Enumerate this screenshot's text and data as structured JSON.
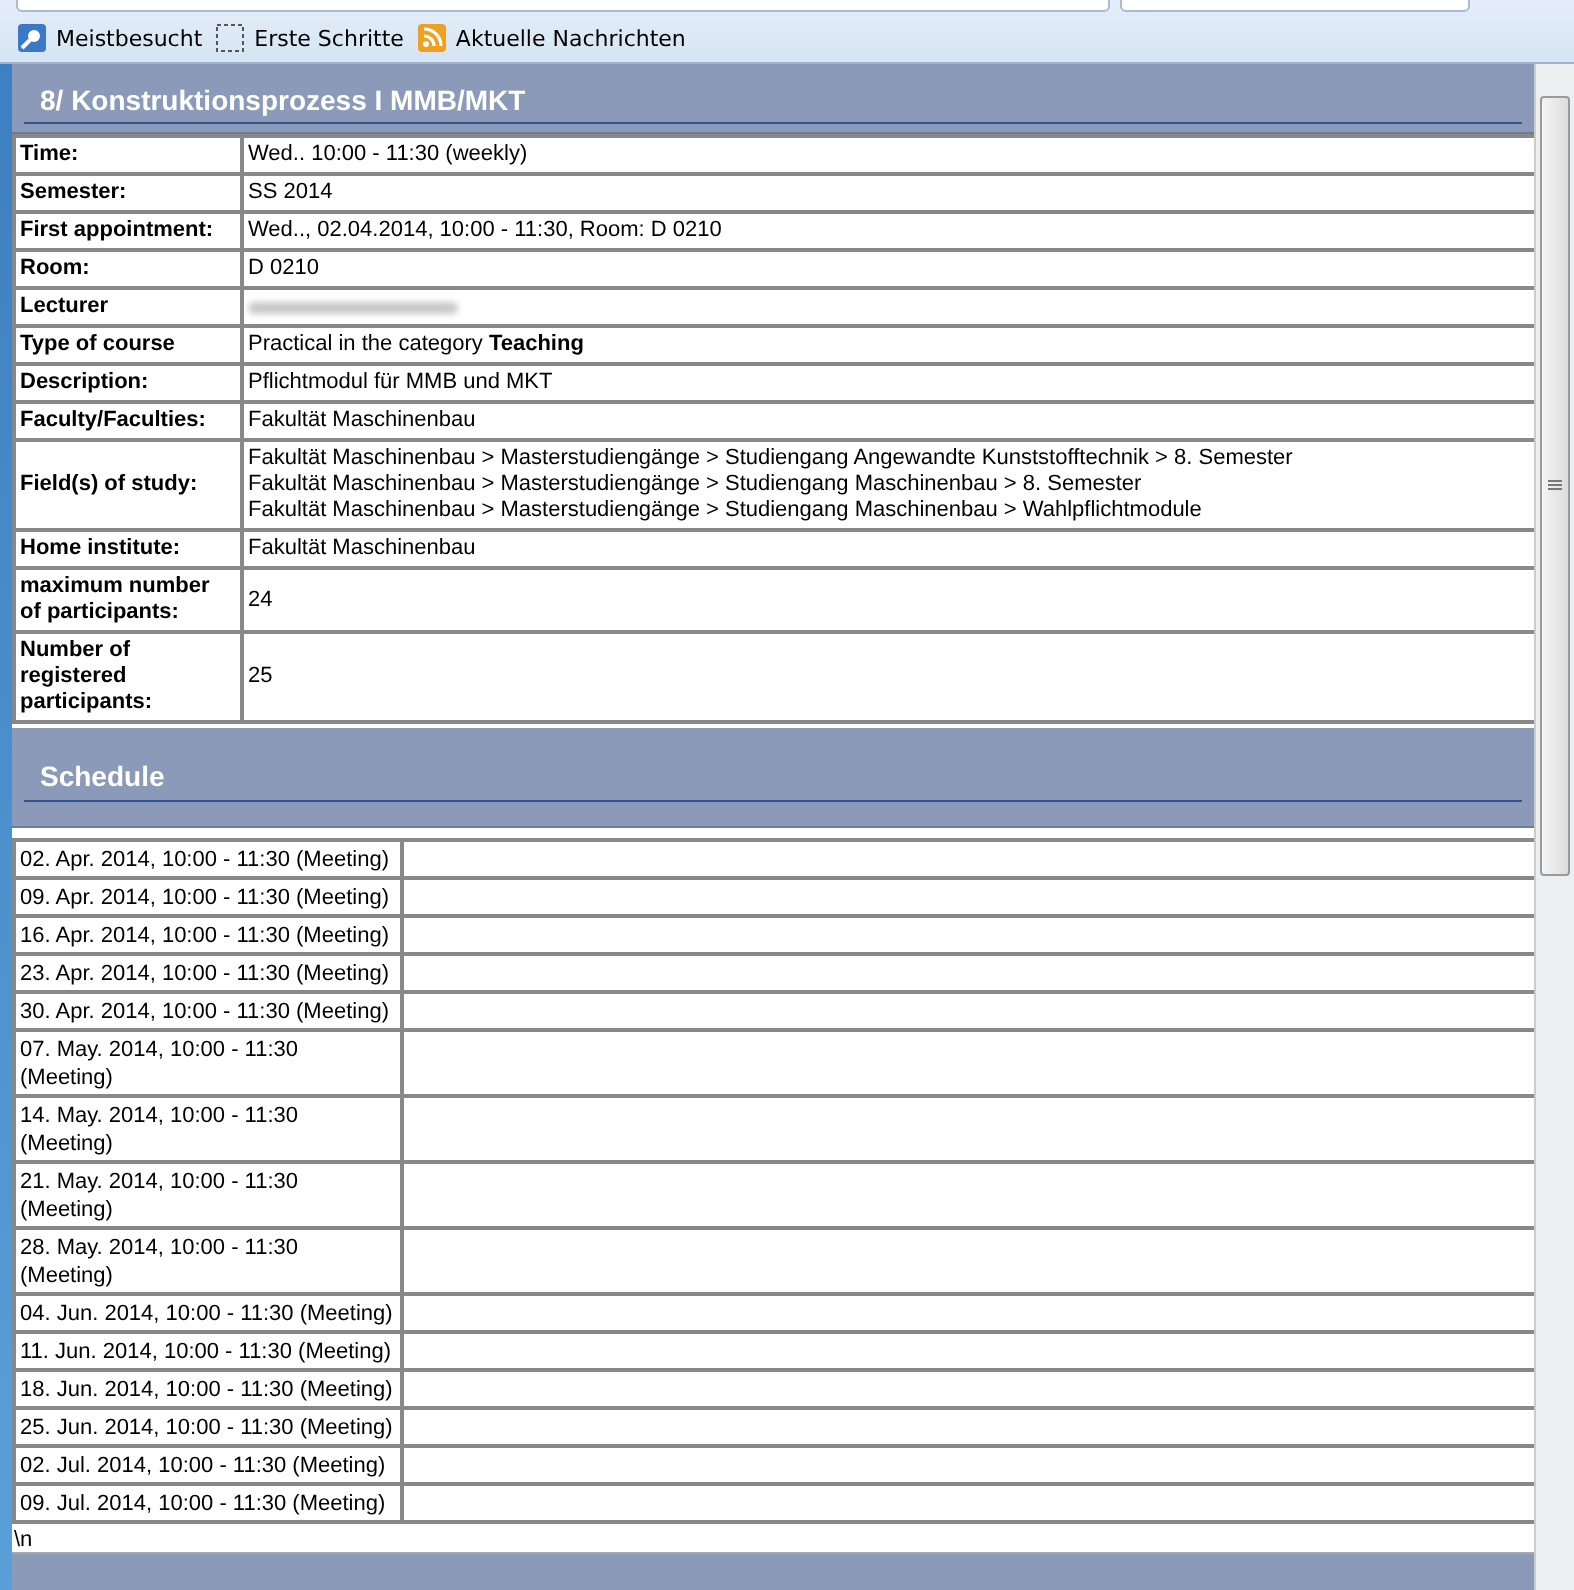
{
  "bookmarks": [
    {
      "label": "Meistbesucht",
      "kind": "search"
    },
    {
      "label": "Erste Schritte",
      "kind": "dashed"
    },
    {
      "label": "Aktuelle Nachrichten",
      "kind": "feed"
    }
  ],
  "course": {
    "title": "8/ Konstruktionsprozess I MMB/MKT",
    "details": [
      {
        "label": "Time:",
        "values": [
          "Wed.. 10:00 - 11:30 (weekly)"
        ]
      },
      {
        "label": "Semester:",
        "values": [
          "SS 2014"
        ]
      },
      {
        "label": "First appointment:",
        "values": [
          "Wed.., 02.04.2014, 10:00 - 11:30, Room: D 0210"
        ]
      },
      {
        "label": "Room:",
        "values": [
          "D 0210"
        ]
      },
      {
        "label": "Lecturer",
        "kind": "redacted"
      },
      {
        "label": "Type of course",
        "values": [
          "Practical in the category **Teaching**"
        ]
      },
      {
        "label": "Description:",
        "values": [
          "Pflichtmodul für MMB und MKT"
        ]
      },
      {
        "label": "Faculty/Faculties:",
        "values": [
          "Fakultät Maschinenbau"
        ]
      },
      {
        "label": "Field(s) of study:",
        "values": [
          "Fakultät Maschinenbau > Masterstudiengänge > Studiengang Angewandte Kunststofftechnik > 8. Semester",
          "Fakultät Maschinenbau > Masterstudiengänge > Studiengang Maschinenbau > 8. Semester",
          "Fakultät Maschinenbau > Masterstudiengänge > Studiengang Maschinenbau > Wahlpflichtmodule"
        ]
      },
      {
        "label": "Home institute:",
        "values": [
          "Fakultät Maschinenbau"
        ]
      },
      {
        "label": "maximum number of participants:",
        "values": [
          "24"
        ]
      },
      {
        "label": "Number of registered participants:",
        "values": [
          "25"
        ]
      }
    ]
  },
  "schedule": {
    "title": "Schedule",
    "dates": [
      "02. Apr. 2014, 10:00 - 11:30 (Meeting)",
      "09. Apr. 2014, 10:00 - 11:30 (Meeting)",
      "16. Apr. 2014, 10:00 - 11:30 (Meeting)",
      "23. Apr. 2014, 10:00 - 11:30 (Meeting)",
      "30. Apr. 2014, 10:00 - 11:30 (Meeting)",
      "07. May. 2014, 10:00 - 11:30 (Meeting)",
      "14. May. 2014, 10:00 - 11:30 (Meeting)",
      "21. May. 2014, 10:00 - 11:30 (Meeting)",
      "28. May. 2014, 10:00 - 11:30 (Meeting)",
      "04. Jun. 2014, 10:00 - 11:30 (Meeting)",
      "11. Jun. 2014, 10:00 - 11:30 (Meeting)",
      "18. Jun. 2014, 10:00 - 11:30 (Meeting)",
      "25. Jun. 2014, 10:00 - 11:30 (Meeting)",
      "02. Jul. 2014, 10:00 - 11:30 (Meeting)",
      "09. Jul. 2014, 10:00 - 11:30 (Meeting)"
    ],
    "footer_text": "\\n"
  }
}
